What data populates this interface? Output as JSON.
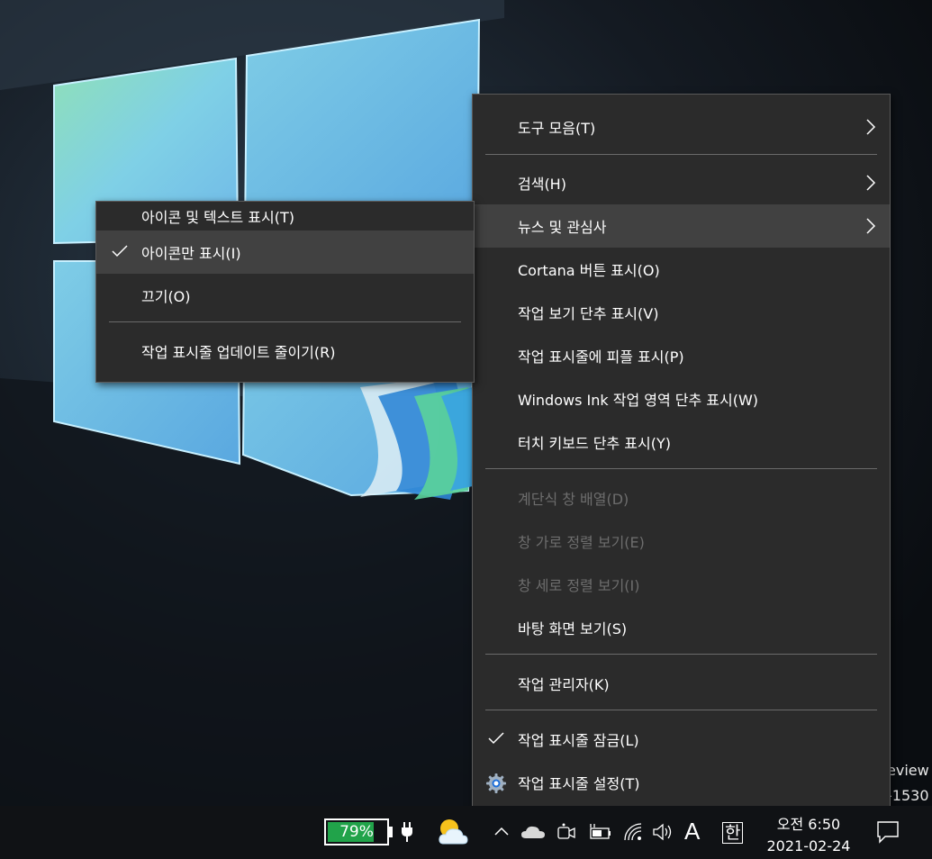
{
  "main_menu": {
    "items": [
      {
        "label": "도구 모음(T)",
        "submenu": true,
        "enabled": true
      },
      {
        "label": "검색(H)",
        "submenu": true,
        "enabled": true
      },
      {
        "label": "뉴스 및 관심사",
        "submenu": true,
        "enabled": true,
        "highlighted": true
      },
      {
        "label": "Cortana 버튼 표시(O)",
        "enabled": true
      },
      {
        "label": "작업 보기 단추 표시(V)",
        "enabled": true
      },
      {
        "label": "작업 표시줄에 피플 표시(P)",
        "enabled": true
      },
      {
        "label": "Windows Ink 작업 영역 단추 표시(W)",
        "enabled": true
      },
      {
        "label": "터치 키보드 단추 표시(Y)",
        "enabled": true
      },
      {
        "label": "계단식 창 배열(D)",
        "enabled": false
      },
      {
        "label": "창 가로 정렬 보기(E)",
        "enabled": false
      },
      {
        "label": "창 세로 정렬 보기(I)",
        "enabled": false
      },
      {
        "label": "바탕 화면 보기(S)",
        "enabled": true
      },
      {
        "label": "작업 관리자(K)",
        "enabled": true
      },
      {
        "label": "작업 표시줄 잠금(L)",
        "enabled": true,
        "checked": true
      },
      {
        "label": "작업 표시줄 설정(T)",
        "enabled": true,
        "icon": "gear-icon"
      }
    ]
  },
  "sub_menu": {
    "items": [
      {
        "label": "아이콘 및 텍스트 표시(T)"
      },
      {
        "label": "아이콘만 표시(I)",
        "checked": true,
        "highlighted": true
      },
      {
        "label": "끄기(O)"
      },
      {
        "label": "작업 표시줄 업데이트 줄이기(R)"
      }
    ]
  },
  "watermark": {
    "line1": "eview",
    "line2": "-1530"
  },
  "taskbar": {
    "battery_percent": "79%",
    "battery_level": 0.79,
    "ime_mode": "A",
    "ime_lang": "한",
    "time": "오전 6:50",
    "date": "2021-02-24",
    "tray_icons": [
      "chevron-up-icon",
      "onedrive-cloud-icon",
      "meet-now-icon",
      "power-battery-icon",
      "wifi-icon",
      "volume-icon"
    ]
  },
  "colors": {
    "menu_bg": "#2b2b2b",
    "menu_highlight": "#414141",
    "disabled_text": "#6d6d6d",
    "battery_fill": "#21a34a",
    "taskbar_bg": "#101215"
  }
}
